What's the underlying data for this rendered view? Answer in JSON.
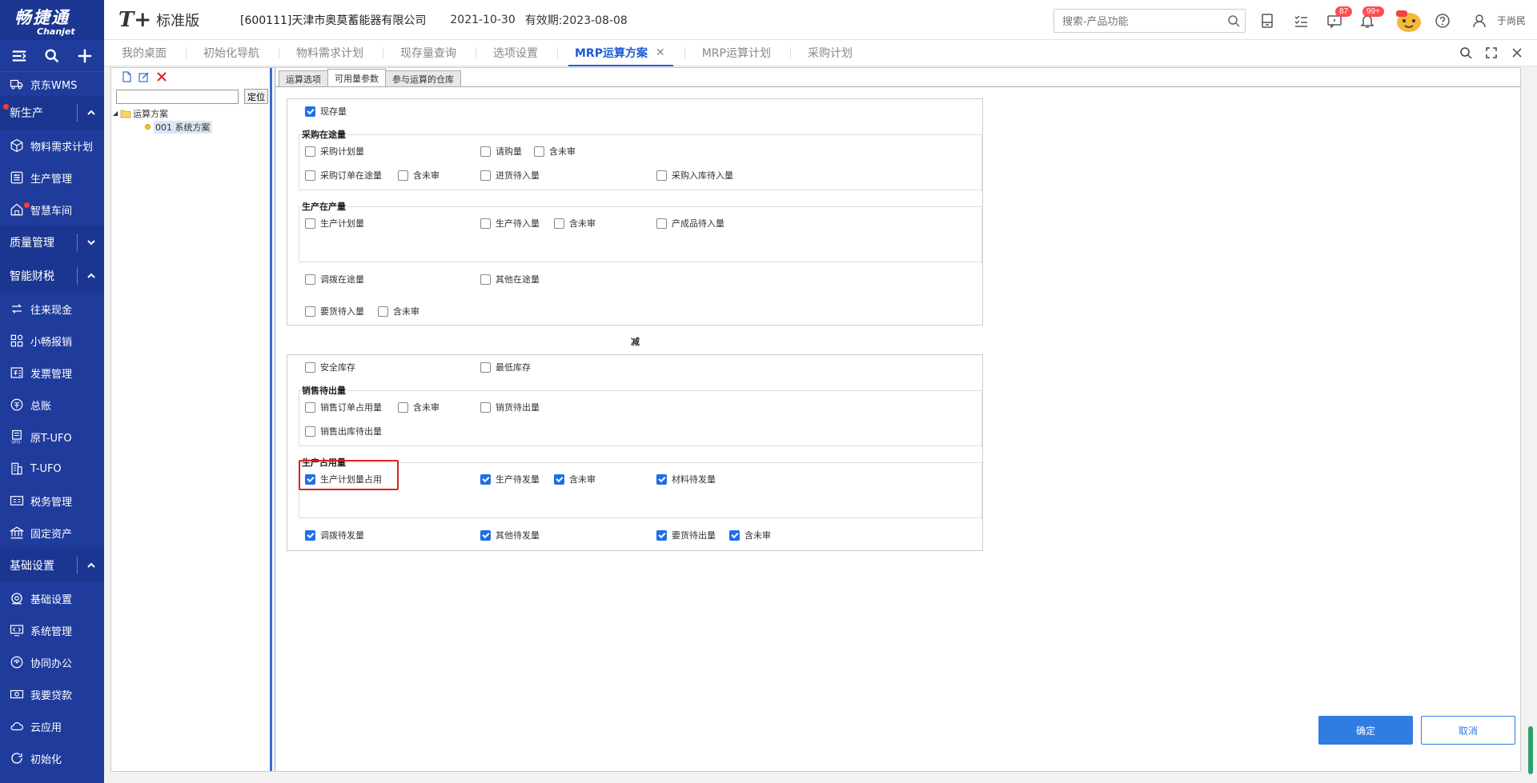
{
  "sidebar": {
    "logo_cn": "畅捷通",
    "logo_en": "Chanjet",
    "items_top": [
      {
        "label": "京东WMS"
      }
    ],
    "group_new_production": "新生产",
    "new_production_items": [
      {
        "label": "物料需求计划"
      },
      {
        "label": "生产管理"
      },
      {
        "label": "智慧车间"
      }
    ],
    "group_quality": "质量管理",
    "group_finance": "智能财税",
    "finance_items": [
      {
        "label": "往来现金"
      },
      {
        "label": "小畅报销"
      },
      {
        "label": "发票管理"
      },
      {
        "label": "总账"
      },
      {
        "label": "原T-UFO"
      },
      {
        "label": "T-UFO"
      },
      {
        "label": "税务管理"
      },
      {
        "label": "固定资产"
      }
    ],
    "group_basic": "基础设置",
    "basic_items": [
      {
        "label": "基础设置"
      },
      {
        "label": "系统管理"
      },
      {
        "label": "协同办公"
      },
      {
        "label": "我要贷款"
      },
      {
        "label": "云应用"
      },
      {
        "label": "初始化"
      }
    ]
  },
  "topbar": {
    "brand": "T+",
    "edition": "标准版",
    "company": "[600111]天津市奥莫蓄能器有限公司",
    "date": "2021-10-30",
    "valid": "有效期:2023-08-08",
    "search_placeholder": "搜索-产品功能",
    "badge_messages": "87",
    "badge_notifications": "99+",
    "user": "于尚民"
  },
  "tabs": [
    {
      "label": "我的桌面"
    },
    {
      "label": "初始化导航"
    },
    {
      "label": "物料需求计划"
    },
    {
      "label": "现存量查询"
    },
    {
      "label": "选项设置"
    },
    {
      "label": "MRP运算方案"
    },
    {
      "label": "MRP运算计划"
    },
    {
      "label": "采购计划"
    }
  ],
  "tree": {
    "locate_label": "定位",
    "root": "运算方案",
    "child": "001 系统方案"
  },
  "sub_tabs": [
    {
      "label": "运算选项"
    },
    {
      "label": "可用量参数"
    },
    {
      "label": "参与运算的仓库"
    }
  ],
  "add_section": {
    "on_hand": {
      "label": "现存量",
      "checked": true
    },
    "purchase_title": "采购在途量",
    "purchase_plan": {
      "label": "采购计划量",
      "checked": false
    },
    "purchase_request": {
      "label": "请购量",
      "checked": false
    },
    "purchase_request_unaudited": {
      "label": "含未审",
      "checked": false
    },
    "purchase_order_transit": {
      "label": "采购订单在途量",
      "checked": false
    },
    "purchase_order_unaudited": {
      "label": "含未审",
      "checked": false
    },
    "incoming_pending": {
      "label": "进货待入量",
      "checked": false
    },
    "purchase_inbound_pending": {
      "label": "采购入库待入量",
      "checked": false
    },
    "production_title": "生产在产量",
    "production_plan": {
      "label": "生产计划量",
      "checked": false
    },
    "production_pending_in": {
      "label": "生产待入量",
      "checked": false
    },
    "production_pending_unaudited": {
      "label": "含未审",
      "checked": false
    },
    "product_pending_in": {
      "label": "产成品待入量",
      "checked": false
    },
    "transfer_transit": {
      "label": "调拨在途量",
      "checked": false
    },
    "other_transit": {
      "label": "其他在途量",
      "checked": false
    },
    "requisition_pending_in": {
      "label": "要货待入量",
      "checked": false
    },
    "requisition_unaudited": {
      "label": "含未审",
      "checked": false
    }
  },
  "minus_label": "减",
  "minus_section": {
    "safety_stock": {
      "label": "安全库存",
      "checked": false
    },
    "min_stock": {
      "label": "最低库存",
      "checked": false
    },
    "sales_title": "销售待出量",
    "sales_order_occupied": {
      "label": "销售订单占用量",
      "checked": false
    },
    "sales_order_unaudited": {
      "label": "含未审",
      "checked": false
    },
    "sales_pending_out": {
      "label": "销货待出量",
      "checked": false
    },
    "sales_outbound_pending": {
      "label": "销售出库待出量",
      "checked": false
    },
    "prod_occupy_title": "生产占用量",
    "prod_plan_occupied": {
      "label": "生产计划量占用",
      "checked": true
    },
    "prod_pending_issue": {
      "label": "生产待发量",
      "checked": true
    },
    "prod_pending_issue_unaudited": {
      "label": "含未审",
      "checked": true
    },
    "material_pending_issue": {
      "label": "材料待发量",
      "checked": true
    },
    "transfer_pending_issue": {
      "label": "调拨待发量",
      "checked": true
    },
    "other_pending_issue": {
      "label": "其他待发量",
      "checked": true
    },
    "requisition_pending_out": {
      "label": "要货待出量",
      "checked": true
    },
    "requisition_out_unaudited": {
      "label": "含未审",
      "checked": true
    }
  },
  "buttons": {
    "ok": "确定",
    "cancel": "取消"
  },
  "colors": {
    "sidebar": "#1f3c9c",
    "accent": "#1f5cd6",
    "checkbox": "#1e6fe8",
    "highlight": "#e02020"
  }
}
